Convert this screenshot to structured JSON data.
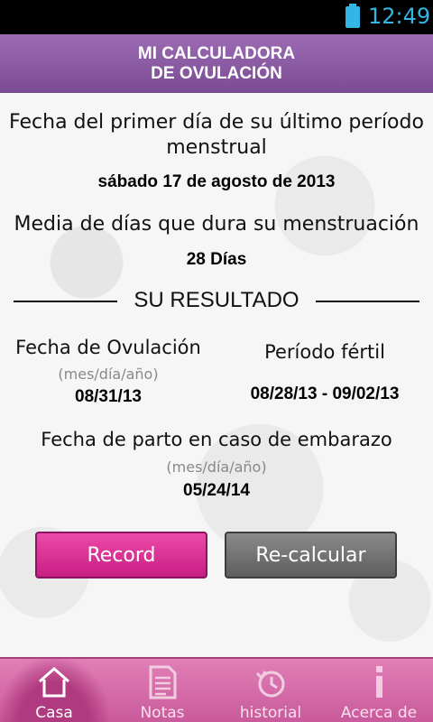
{
  "status": {
    "time": "12:49"
  },
  "header": {
    "title_line1": "MI CALCULADORA",
    "title_line2": "DE OVULACIÓN"
  },
  "period": {
    "label_line1": "Fecha del primer día de su último período",
    "label_line2": "menstrual",
    "value": "sábado 17 de agosto de 2013"
  },
  "cycle": {
    "label": "Media de días que dura su menstruación",
    "value": "28 Días"
  },
  "result": {
    "title": "SU RESULTADO"
  },
  "ovulation": {
    "label": "Fecha de Ovulación",
    "hint": "(mes/día/año)",
    "value": "08/31/13"
  },
  "fertile": {
    "label": "Período fértil",
    "value": "08/28/13 - 09/02/13"
  },
  "due": {
    "label": "Fecha de parto en caso de embarazo",
    "hint": "(mes/día/año)",
    "value": "05/24/14"
  },
  "buttons": {
    "record": "Record",
    "recalc": "Re-calcular"
  },
  "tabs": [
    {
      "label": "Casa",
      "icon": "home-icon"
    },
    {
      "label": "Notas",
      "icon": "notes-icon"
    },
    {
      "label": "historial",
      "icon": "history-icon"
    },
    {
      "label": "Acerca de",
      "icon": "info-icon"
    }
  ],
  "colors": {
    "header": "#8a5aa4",
    "status_accent": "#33b5e5",
    "record": "#d9318f",
    "recalc": "#6f6f6f",
    "tabbar": "#d96aa9"
  }
}
